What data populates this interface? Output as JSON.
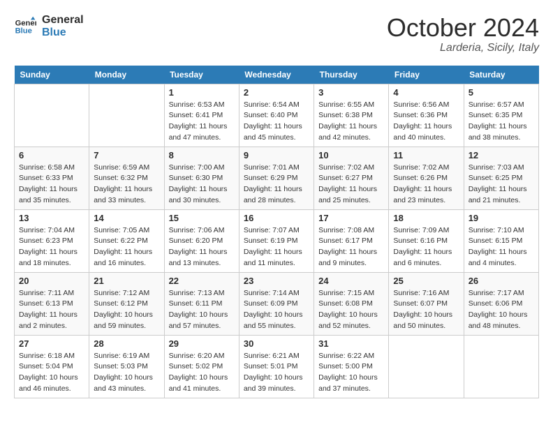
{
  "header": {
    "logo_line1": "General",
    "logo_line2": "Blue",
    "month": "October 2024",
    "location": "Larderia, Sicily, Italy"
  },
  "weekdays": [
    "Sunday",
    "Monday",
    "Tuesday",
    "Wednesday",
    "Thursday",
    "Friday",
    "Saturday"
  ],
  "weeks": [
    [
      null,
      null,
      {
        "day": 1,
        "sunrise": "6:53 AM",
        "sunset": "6:41 PM",
        "daylight": "11 hours and 47 minutes."
      },
      {
        "day": 2,
        "sunrise": "6:54 AM",
        "sunset": "6:40 PM",
        "daylight": "11 hours and 45 minutes."
      },
      {
        "day": 3,
        "sunrise": "6:55 AM",
        "sunset": "6:38 PM",
        "daylight": "11 hours and 42 minutes."
      },
      {
        "day": 4,
        "sunrise": "6:56 AM",
        "sunset": "6:36 PM",
        "daylight": "11 hours and 40 minutes."
      },
      {
        "day": 5,
        "sunrise": "6:57 AM",
        "sunset": "6:35 PM",
        "daylight": "11 hours and 38 minutes."
      }
    ],
    [
      {
        "day": 6,
        "sunrise": "6:58 AM",
        "sunset": "6:33 PM",
        "daylight": "11 hours and 35 minutes."
      },
      {
        "day": 7,
        "sunrise": "6:59 AM",
        "sunset": "6:32 PM",
        "daylight": "11 hours and 33 minutes."
      },
      {
        "day": 8,
        "sunrise": "7:00 AM",
        "sunset": "6:30 PM",
        "daylight": "11 hours and 30 minutes."
      },
      {
        "day": 9,
        "sunrise": "7:01 AM",
        "sunset": "6:29 PM",
        "daylight": "11 hours and 28 minutes."
      },
      {
        "day": 10,
        "sunrise": "7:02 AM",
        "sunset": "6:27 PM",
        "daylight": "11 hours and 25 minutes."
      },
      {
        "day": 11,
        "sunrise": "7:02 AM",
        "sunset": "6:26 PM",
        "daylight": "11 hours and 23 minutes."
      },
      {
        "day": 12,
        "sunrise": "7:03 AM",
        "sunset": "6:25 PM",
        "daylight": "11 hours and 21 minutes."
      }
    ],
    [
      {
        "day": 13,
        "sunrise": "7:04 AM",
        "sunset": "6:23 PM",
        "daylight": "11 hours and 18 minutes."
      },
      {
        "day": 14,
        "sunrise": "7:05 AM",
        "sunset": "6:22 PM",
        "daylight": "11 hours and 16 minutes."
      },
      {
        "day": 15,
        "sunrise": "7:06 AM",
        "sunset": "6:20 PM",
        "daylight": "11 hours and 13 minutes."
      },
      {
        "day": 16,
        "sunrise": "7:07 AM",
        "sunset": "6:19 PM",
        "daylight": "11 hours and 11 minutes."
      },
      {
        "day": 17,
        "sunrise": "7:08 AM",
        "sunset": "6:17 PM",
        "daylight": "11 hours and 9 minutes."
      },
      {
        "day": 18,
        "sunrise": "7:09 AM",
        "sunset": "6:16 PM",
        "daylight": "11 hours and 6 minutes."
      },
      {
        "day": 19,
        "sunrise": "7:10 AM",
        "sunset": "6:15 PM",
        "daylight": "11 hours and 4 minutes."
      }
    ],
    [
      {
        "day": 20,
        "sunrise": "7:11 AM",
        "sunset": "6:13 PM",
        "daylight": "11 hours and 2 minutes."
      },
      {
        "day": 21,
        "sunrise": "7:12 AM",
        "sunset": "6:12 PM",
        "daylight": "10 hours and 59 minutes."
      },
      {
        "day": 22,
        "sunrise": "7:13 AM",
        "sunset": "6:11 PM",
        "daylight": "10 hours and 57 minutes."
      },
      {
        "day": 23,
        "sunrise": "7:14 AM",
        "sunset": "6:09 PM",
        "daylight": "10 hours and 55 minutes."
      },
      {
        "day": 24,
        "sunrise": "7:15 AM",
        "sunset": "6:08 PM",
        "daylight": "10 hours and 52 minutes."
      },
      {
        "day": 25,
        "sunrise": "7:16 AM",
        "sunset": "6:07 PM",
        "daylight": "10 hours and 50 minutes."
      },
      {
        "day": 26,
        "sunrise": "7:17 AM",
        "sunset": "6:06 PM",
        "daylight": "10 hours and 48 minutes."
      }
    ],
    [
      {
        "day": 27,
        "sunrise": "6:18 AM",
        "sunset": "5:04 PM",
        "daylight": "10 hours and 46 minutes."
      },
      {
        "day": 28,
        "sunrise": "6:19 AM",
        "sunset": "5:03 PM",
        "daylight": "10 hours and 43 minutes."
      },
      {
        "day": 29,
        "sunrise": "6:20 AM",
        "sunset": "5:02 PM",
        "daylight": "10 hours and 41 minutes."
      },
      {
        "day": 30,
        "sunrise": "6:21 AM",
        "sunset": "5:01 PM",
        "daylight": "10 hours and 39 minutes."
      },
      {
        "day": 31,
        "sunrise": "6:22 AM",
        "sunset": "5:00 PM",
        "daylight": "10 hours and 37 minutes."
      },
      null,
      null
    ]
  ]
}
